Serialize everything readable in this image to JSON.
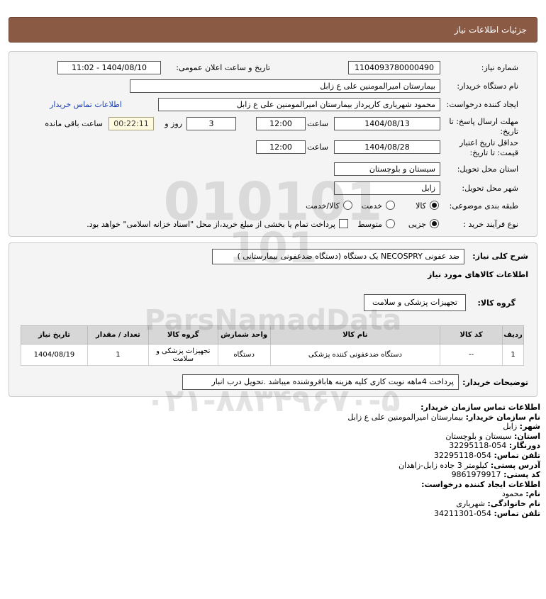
{
  "header": {
    "title": "جزئیات اطلاعات نیاز"
  },
  "form": {
    "need_number_label": "شماره نیاز:",
    "need_number": "1104093780000490",
    "announce_label": "تاریخ و ساعت اعلان عمومی:",
    "announce_value": "1404/08/10 - 11:02",
    "buyer_org_label": "نام دستگاه خریدار:",
    "buyer_org": "بیمارستان امیرالمومنین علی  ع  زابل",
    "creator_label": "ایجاد کننده درخواست:",
    "creator": "محمود شهریاری کارپرداز بیمارستان امیرالمومنین علی  ع  زابل",
    "buyer_contact_link": "اطلاعات تماس خریدار",
    "deadline_label_1": "مهلت ارسال پاسخ: تا",
    "deadline_label_2": "تاریخ:",
    "deadline_date": "1404/08/13",
    "time_label": "ساعت",
    "deadline_time": "12:00",
    "days_value": "3",
    "days_label": "روز و",
    "remaining_time": "00:22:11",
    "remaining_label": "ساعت باقی مانده",
    "validity_label_1": "حداقل تاریخ اعتبار",
    "validity_label_2": "قیمت: تا تاریخ:",
    "validity_date": "1404/08/28",
    "validity_time": "12:00",
    "province_label": "استان محل تحویل:",
    "province": "سیستان و بلوچستان",
    "city_label": "شهر محل تحویل:",
    "city": "زابل",
    "category_label": "طبقه بندی موضوعی:",
    "category_options": [
      "کالا",
      "خدمت",
      "کالا/خدمت"
    ],
    "purchase_label": "نوع فرآیند خرید :",
    "purchase_options": [
      "جزیی",
      "متوسط"
    ],
    "purchase_note": "پرداخت تمام یا بخشی از مبلغ خرید،از محل \"اسناد خزانه اسلامی\" خواهد بود."
  },
  "details": {
    "summary_label": "شرح کلی نیاز:",
    "summary": "ضد عفونی NECOSPRY یک دستگاه (دستگاه ضدعفونی بیمارستانی )",
    "goods_info_title": "اطلاعات کالاهای مورد نیاز",
    "goods_group_label": "گروه کالا:",
    "goods_group": "تجهیزات پزشکی و سلامت",
    "table": {
      "headers": [
        "ردیف",
        "کد کالا",
        "نام کالا",
        "واحد شمارش",
        "گروه کالا",
        "تعداد / مقدار",
        "تاریخ نیاز"
      ],
      "rows": [
        [
          "1",
          "--",
          "دستگاه ضدعفونی کننده پزشکی",
          "دستگاه",
          "تجهیزات پزشکی و سلامت",
          "1",
          "1404/08/19"
        ]
      ]
    },
    "buyer_notes_label": "توضیحات خریدار:",
    "buyer_notes": "پرداخت 4ماهه نوبت کاری کلیه هزینه هابافروشنده میباشد .تحویل درب انبار"
  },
  "contact": {
    "org_title": "اطلاعات تماس سازمان خریدار:",
    "org_name_label": "نام سازمان خریدار:",
    "org_name": "بیمارستان امیرالمومنین علی ع زابل",
    "city_label": "شهر:",
    "city": "زابل",
    "province_label": "استان:",
    "province": "سیستان و بلوچستان",
    "fax_label": "دورنگار:",
    "fax": "054-32295118",
    "phone_label": "تلفن تماس:",
    "phone": "054-32295118",
    "address_label": "آدرس پستی:",
    "address": "کیلومتر 3 جاده زابل-زاهدان",
    "postal_label": "کد پستی:",
    "postal": "9861979917",
    "creator_title": "اطلاعات ایجاد کننده درخواست:",
    "first_name_label": "نام:",
    "first_name": "محمود",
    "last_name_label": "نام خانوادگی:",
    "last_name": "شهریاری",
    "creator_phone_label": "تلفن تماس:",
    "creator_phone": "054-34211301"
  },
  "watermark": {
    "text": "ParsNamadData",
    "phone": "۰۲۱-۸۸۳۴۹۶۷۰-۵"
  }
}
